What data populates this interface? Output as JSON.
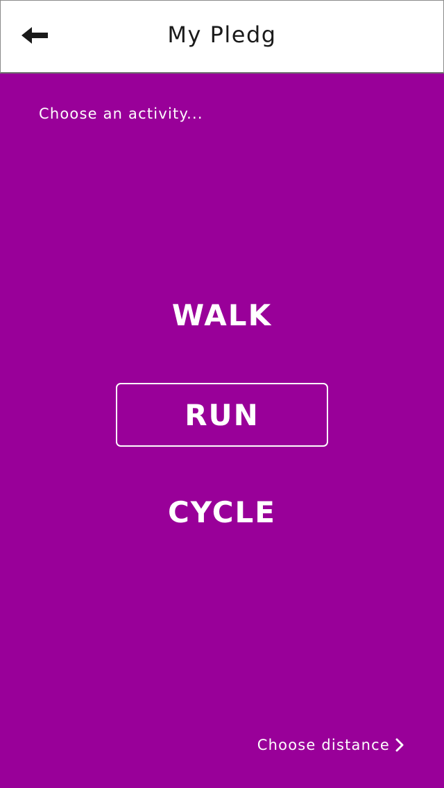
{
  "header": {
    "title": "My Pledg",
    "back_icon": "arrow-left-icon"
  },
  "main": {
    "prompt": "Choose an activity...",
    "activities": [
      {
        "label": "WALK",
        "selected": false
      },
      {
        "label": "RUN",
        "selected": true
      },
      {
        "label": "CYCLE",
        "selected": false
      }
    ]
  },
  "footer": {
    "next_label": "Choose distance",
    "next_icon": "chevron-right-icon"
  },
  "colors": {
    "background": "#990099",
    "header_bg": "#ffffff",
    "text_light": "#ffffff",
    "text_dark": "#1a1a1a"
  }
}
